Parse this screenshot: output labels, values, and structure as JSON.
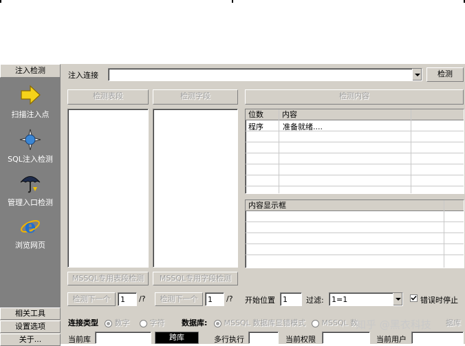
{
  "sidebar": {
    "header": "注入检测",
    "items": [
      {
        "label": "扫描注入点",
        "icon": "arrow-right-icon"
      },
      {
        "label": "SQL注入检测",
        "icon": "compass-icon"
      },
      {
        "label": "管理入口检测",
        "icon": "umbrella-icon"
      },
      {
        "label": "浏览网页",
        "icon": "ie-browser-icon"
      }
    ],
    "bottom_buttons": [
      "相关工具",
      "设置选项",
      "关于..."
    ]
  },
  "toolbar": {
    "url_label": "注入连接",
    "url_value": "",
    "detect_button": "检测"
  },
  "columns": {
    "table_button": "检测表段",
    "field_button": "检测字段",
    "content_button": "检测内容",
    "mssql_table_button": "MSSQL专用表段检测",
    "mssql_field_button": "MSSQL专用字段检测"
  },
  "content_table": {
    "headers": [
      "位数",
      "内容"
    ],
    "rows": [
      [
        "程序",
        "准备就绪...."
      ]
    ]
  },
  "content_display": {
    "title": "内容显示框"
  },
  "pager": {
    "table_next": "检测下一个",
    "table_index": "1",
    "table_total": "/?",
    "field_next": "检测下一个",
    "field_index": "1",
    "field_total": "/?",
    "start_label": "开始位置",
    "start_value": "1",
    "filter_label": "过滤:",
    "filter_value": "1=1",
    "stop_on_error": "错误时停止",
    "stop_on_error_checked": true
  },
  "options": {
    "conn_type_label": "连接类型",
    "conn_type_numeric": "数字",
    "conn_type_char": "字符",
    "db_label": "数据库:",
    "db_opt1": "MSSQL 数据库显错模式",
    "db_opt2": "MSSQL 数",
    "db_opt3": "据库"
  },
  "status": {
    "current_db_label": "当前库",
    "current_db_value": "",
    "cross_db_button": "跨库",
    "multiline_label": "多行执行",
    "multiline_value": "",
    "current_perm_label": "当前权限",
    "current_perm_value": "",
    "current_user_label": "当前用户",
    "current_user_value": ""
  },
  "watermark": "知乎 @黑衣科技"
}
